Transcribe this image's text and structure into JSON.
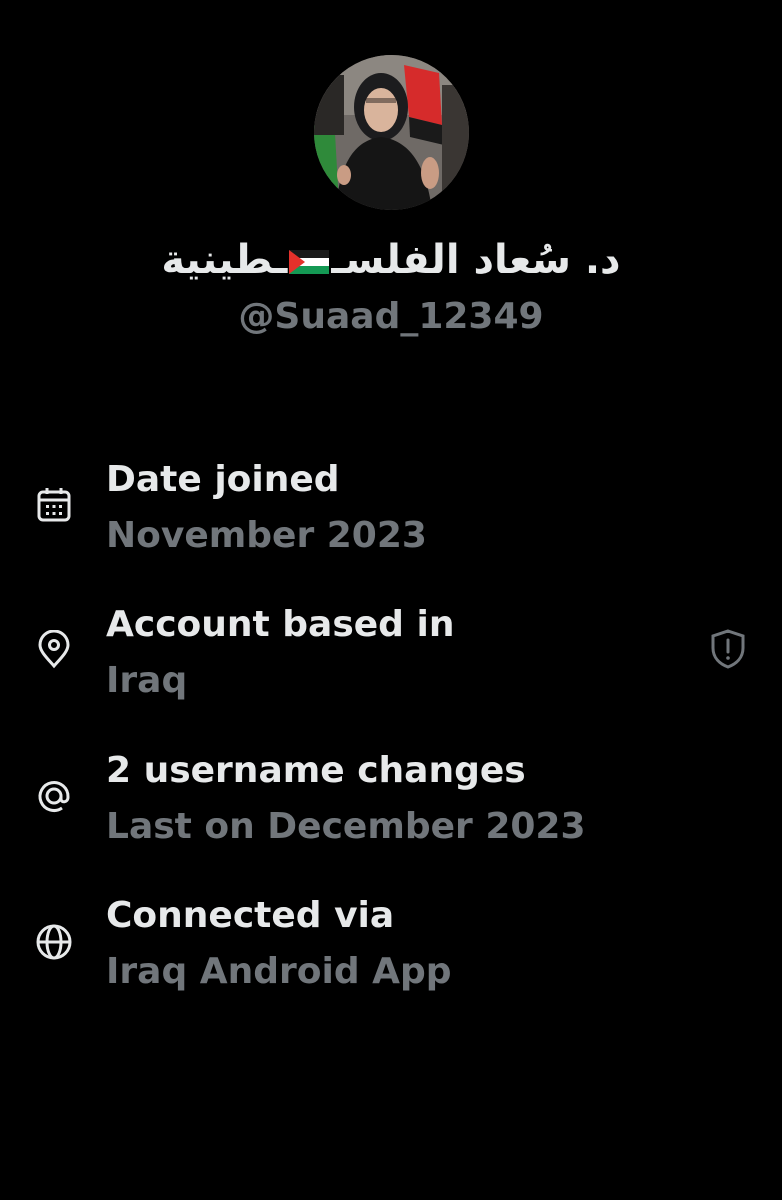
{
  "profile": {
    "display_name_arabic_prefix": "د. سُعاد الفلسـ",
    "display_name_arabic_suffix": "ـطينية",
    "flag_emoji": "palestine-flag",
    "handle": "@Suaad_12349"
  },
  "about": {
    "items": [
      {
        "icon": "calendar-icon",
        "title": "Date joined",
        "value": "November 2023"
      },
      {
        "icon": "location-pin-icon",
        "title": "Account based in",
        "value": "Iraq"
      },
      {
        "icon": "at-sign-icon",
        "title": "2 username changes",
        "value": "Last on December 2023"
      },
      {
        "icon": "globe-icon",
        "title": "Connected via",
        "value": "Iraq Android App"
      }
    ],
    "verification_badge_icon": "shield-alert-icon"
  },
  "colors": {
    "background": "#000000",
    "primary_text": "#e7e9ea",
    "secondary_text": "#71767b"
  }
}
